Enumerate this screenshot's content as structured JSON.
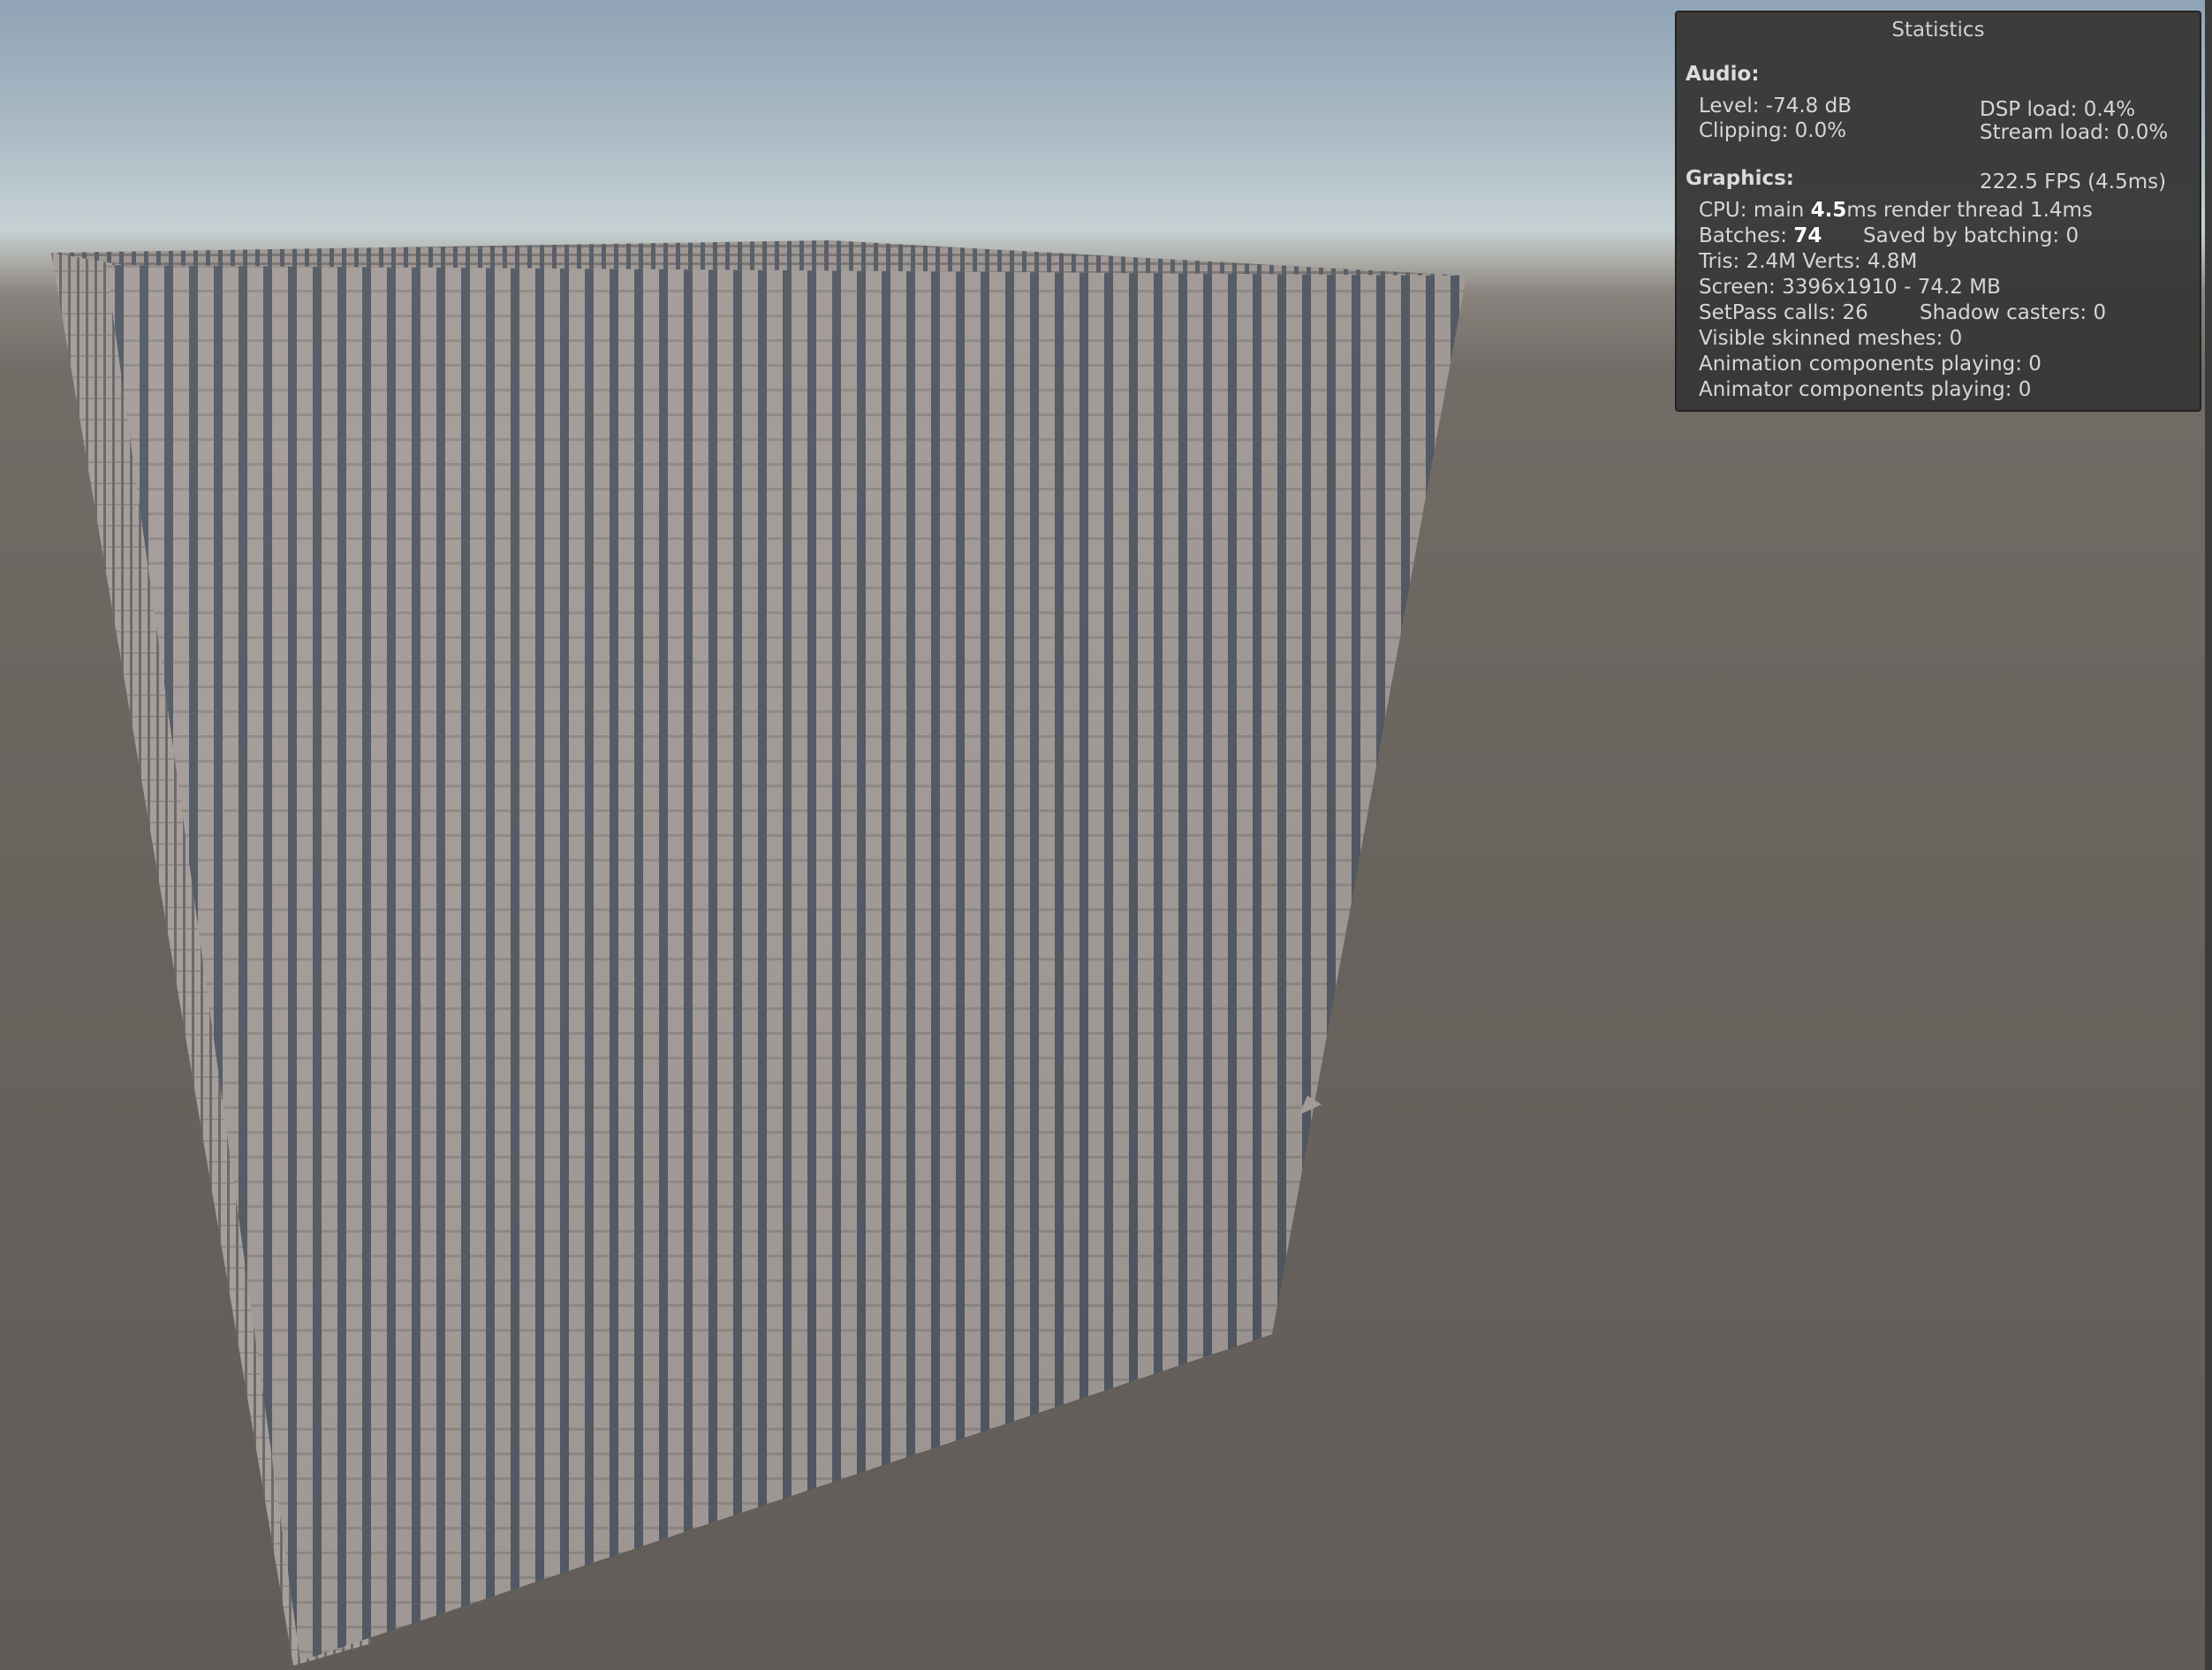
{
  "window": {
    "title": "Statistics"
  },
  "audio": {
    "heading": "Audio:",
    "level": "Level: -74.8 dB",
    "clipping": "Clipping: 0.0%",
    "dsp_load": "DSP load: 0.4%",
    "stream_load": "Stream load: 0.0%"
  },
  "graphics": {
    "heading": "Graphics:",
    "fps": "222.5 FPS (4.5ms)",
    "cpu_label": "CPU: main ",
    "cpu_main": "4.5",
    "cpu_rest": "ms  render thread 1.4ms",
    "batches_label": "Batches: ",
    "batches": "74",
    "saved_by_batching": "Saved by batching: 0",
    "tris_verts": "Tris: 2.4M Verts: 4.8M",
    "screen": "Screen: 3396x1910 - 74.2 MB",
    "setpass": "SetPass calls: 26",
    "shadow_casters": "Shadow casters: 0",
    "visible_skinned": "Visible skinned meshes: 0",
    "animation_components": "Animation components playing: 0",
    "animator_components": "Animator components playing: 0"
  },
  "colors": {
    "panel_bg": "#383838",
    "panel_text": "#d6d6d6",
    "cube_face": "#a09894",
    "cube_gap": "#4f5660",
    "sky_top": "#8fa4b6",
    "ground": "#66615c"
  },
  "scene": {
    "object": "cube grid of instanced cubes",
    "icon_name": "cube-grid"
  }
}
